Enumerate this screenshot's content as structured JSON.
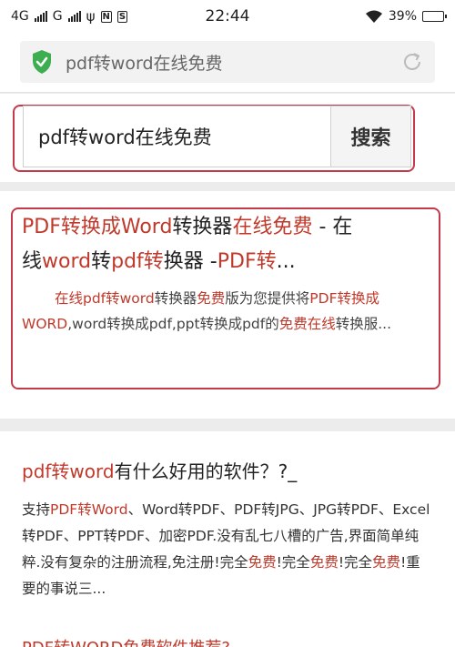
{
  "status_bar": {
    "network_1": "4G",
    "network_2": "G",
    "time": "22:44",
    "battery": "39%"
  },
  "url_bar": {
    "text": "pdf转word在线免费",
    "security_icon": "shield-check-icon",
    "reload_icon": "reload-icon",
    "accent_color": "#3dae4f"
  },
  "search": {
    "value": "pdf转word在线免费",
    "button_label": "搜索",
    "highlight_color": "#c53a4a"
  },
  "results": [
    {
      "title_line1": [
        {
          "t": "PDF转换成Word",
          "h": true
        },
        {
          "t": "转换器",
          "h": false
        },
        {
          "t": "在线免费",
          "h": true
        },
        {
          "t": " - 在",
          "h": false
        }
      ],
      "title_line2": [
        {
          "t": "线",
          "h": false
        },
        {
          "t": "word",
          "h": true
        },
        {
          "t": "转",
          "h": false
        },
        {
          "t": "pdf转",
          "h": true
        },
        {
          "t": "换器 -",
          "h": false
        },
        {
          "t": "PDF转",
          "h": true
        },
        {
          "t": "...",
          "h": false
        }
      ],
      "snippet": [
        {
          "t": "在线pdf转word",
          "h": true
        },
        {
          "t": "转换器",
          "h": false
        },
        {
          "t": "免费",
          "h": true
        },
        {
          "t": "版为您提供将",
          "h": false
        },
        {
          "t": "PDF转换成WORD",
          "h": true
        },
        {
          "t": ",word转换成pdf,ppt转换成pdf的",
          "h": false
        },
        {
          "t": "免费在线",
          "h": true
        },
        {
          "t": "转换服...",
          "h": false
        }
      ]
    },
    {
      "title": [
        {
          "t": "pdf转word",
          "h": true
        },
        {
          "t": "有什么好用的软件？?_",
          "h": false
        }
      ],
      "snippet": [
        {
          "t": "支持",
          "h": false
        },
        {
          "t": "PDF转Word",
          "h": true
        },
        {
          "t": "、Word转PDF、PDF转JPG、JPG转PDF、Excel转PDF、PPT转PDF、加密PDF.没有乱七八槽的广告,界面简单纯粹.没有复杂的注册流程,免注册!完全",
          "h": false
        },
        {
          "t": "免费",
          "h": true
        },
        {
          "t": "!完全",
          "h": false
        },
        {
          "t": "免费",
          "h": true
        },
        {
          "t": "!完全",
          "h": false
        },
        {
          "t": "免费",
          "h": true
        },
        {
          "t": "!重要的事说三...",
          "h": false
        }
      ]
    }
  ],
  "next_result_peek": "PDF转WORD免费软件推荐?"
}
